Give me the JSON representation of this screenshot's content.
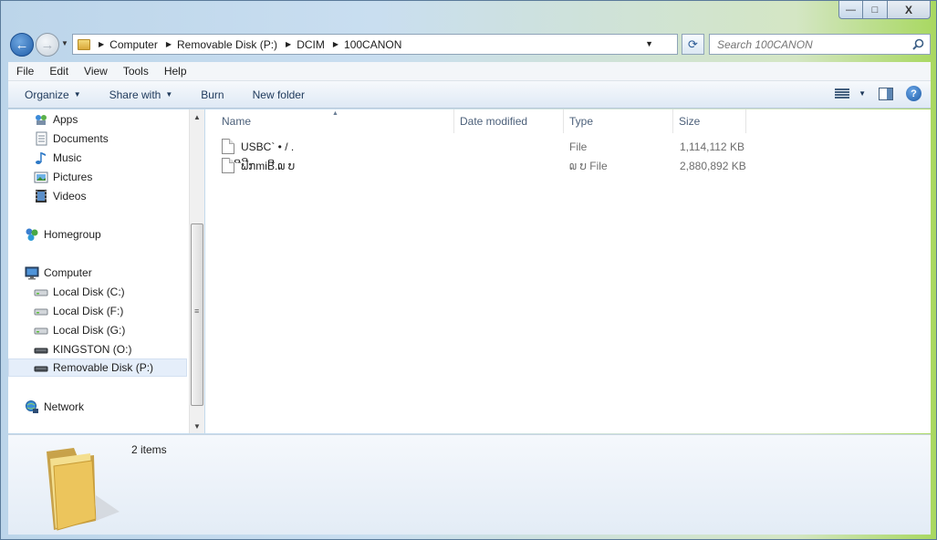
{
  "window": {
    "minimize_glyph": "—",
    "maximize_glyph": "□",
    "close_glyph": "X"
  },
  "nav_buttons": {
    "back_glyph": "←",
    "forward_glyph": "→",
    "recent_glyph": "▼"
  },
  "address": {
    "breadcrumbs": [
      "Computer",
      "Removable Disk (P:)",
      "DCIM",
      "100CANON"
    ],
    "dropdown_glyph": "▼",
    "refresh_glyph": "⟳"
  },
  "search": {
    "placeholder": "Search 100CANON"
  },
  "menu": [
    "File",
    "Edit",
    "View",
    "Tools",
    "Help"
  ],
  "toolbar": {
    "organize": "Organize",
    "share_with": "Share with",
    "burn": "Burn",
    "new_folder": "New folder",
    "dropdown_glyph": "▼",
    "help_glyph": "?"
  },
  "navigation": {
    "libraries": [
      "Apps",
      "Documents",
      "Music",
      "Pictures",
      "Videos"
    ],
    "homegroup": "Homegroup",
    "computer": "Computer",
    "drives": [
      "Local Disk (C:)",
      "Local Disk (F:)",
      "Local Disk (G:)",
      "KINGSTON (O:)",
      "Removable Disk (P:)"
    ],
    "selected_drive": "Removable Disk (P:)",
    "network": "Network"
  },
  "columns": {
    "name": "Name",
    "date_modified": "Date modified",
    "type": "Type",
    "size": "Size"
  },
  "files": [
    {
      "name": "USBC` • / .",
      "date_modified": "",
      "type": "File",
      "size": "1,114,112 KB"
    },
    {
      "name": "ີຟີກmiBີ.໙ ບ",
      "date_modified": "",
      "type": "໙ ບ File",
      "size": "2,880,892 KB"
    }
  ],
  "details": {
    "item_count": "2 items"
  },
  "colors": {
    "accent": "#1f5da8",
    "selection": "#e5eefa",
    "folder": "#e8c153"
  }
}
